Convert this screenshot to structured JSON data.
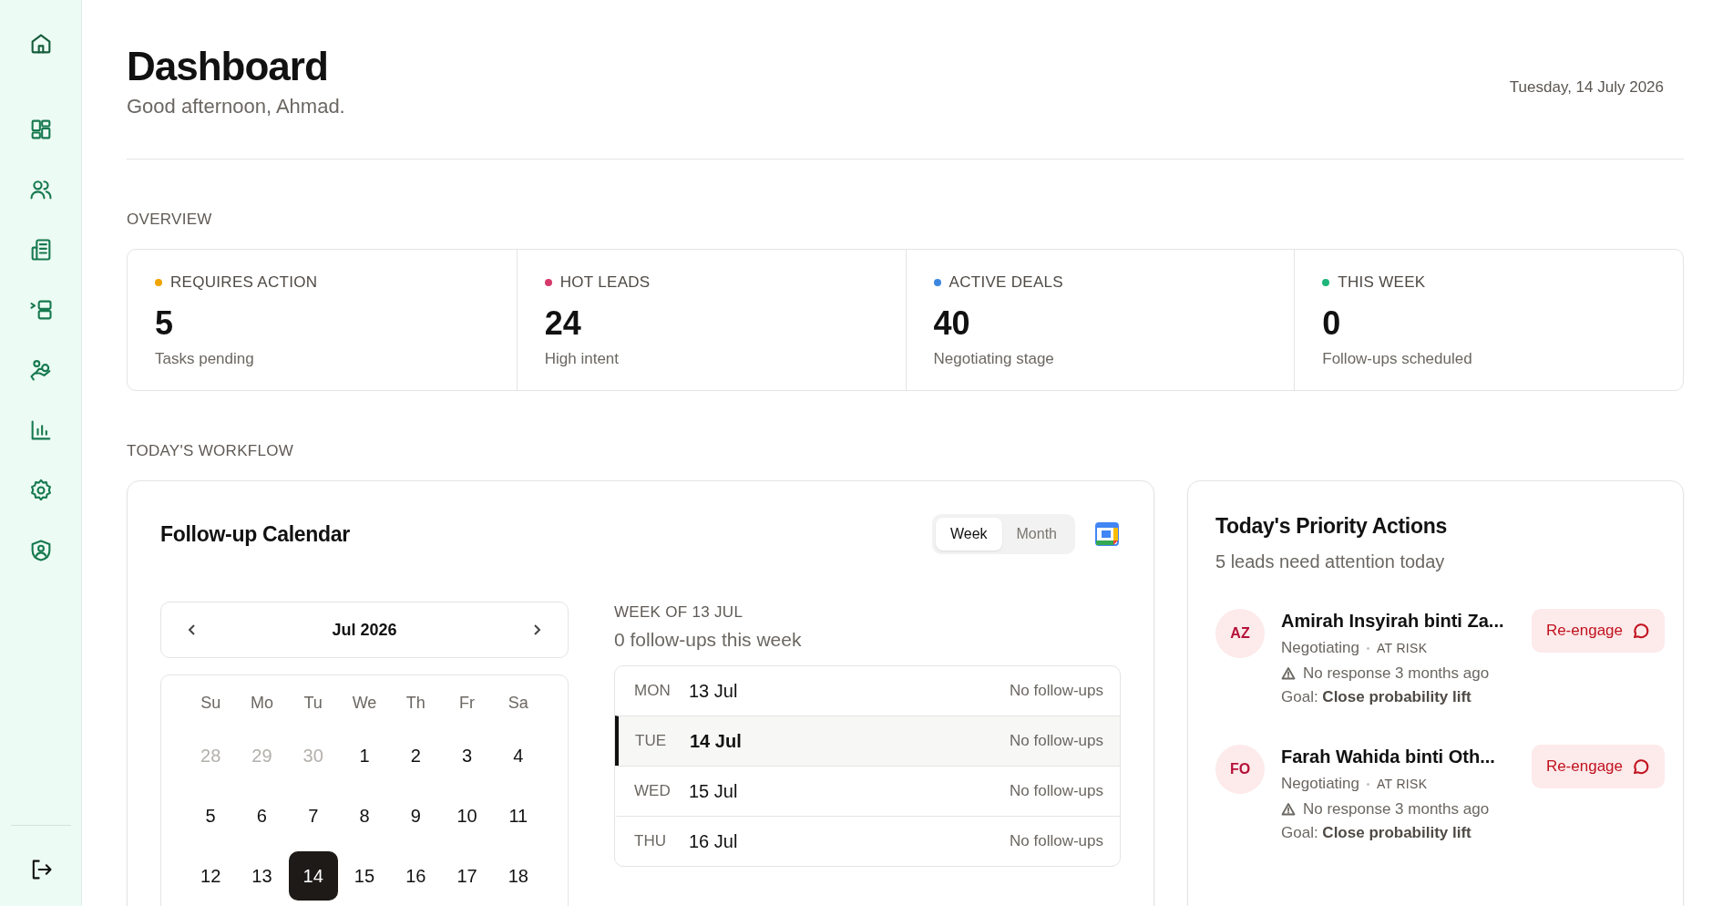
{
  "header": {
    "title": "Dashboard",
    "greeting": "Good afternoon, Ahmad.",
    "date": "Tuesday, 14 July 2026"
  },
  "overview": {
    "heading": "OVERVIEW",
    "cards": [
      {
        "label": "REQUIRES ACTION",
        "color": "#f0a500",
        "value": "5",
        "caption": "Tasks pending"
      },
      {
        "label": "HOT LEADS",
        "color": "#d63a6b",
        "value": "24",
        "caption": "High intent"
      },
      {
        "label": "ACTIVE DEALS",
        "color": "#3b87e0",
        "value": "40",
        "caption": "Negotiating stage"
      },
      {
        "label": "THIS WEEK",
        "color": "#1fb57a",
        "value": "0",
        "caption": "Follow-ups scheduled"
      }
    ]
  },
  "workflow": {
    "heading": "TODAY'S WORKFLOW",
    "calendar": {
      "title": "Follow-up Calendar",
      "views": [
        {
          "label": "Week",
          "selected": true
        },
        {
          "label": "Month",
          "selected": false
        }
      ],
      "month": "Jul 2026",
      "weekdays": [
        "Su",
        "Mo",
        "Tu",
        "We",
        "Th",
        "Fr",
        "Sa"
      ],
      "days": [
        {
          "day": "28",
          "outside": true,
          "selected": false
        },
        {
          "day": "29",
          "outside": true,
          "selected": false
        },
        {
          "day": "30",
          "outside": true,
          "selected": false
        },
        {
          "day": "1",
          "outside": false,
          "selected": false
        },
        {
          "day": "2",
          "outside": false,
          "selected": false
        },
        {
          "day": "3",
          "outside": false,
          "selected": false
        },
        {
          "day": "4",
          "outside": false,
          "selected": false
        },
        {
          "day": "5",
          "outside": false,
          "selected": false
        },
        {
          "day": "6",
          "outside": false,
          "selected": false
        },
        {
          "day": "7",
          "outside": false,
          "selected": false
        },
        {
          "day": "8",
          "outside": false,
          "selected": false
        },
        {
          "day": "9",
          "outside": false,
          "selected": false
        },
        {
          "day": "10",
          "outside": false,
          "selected": false
        },
        {
          "day": "11",
          "outside": false,
          "selected": false
        },
        {
          "day": "12",
          "outside": false,
          "selected": false
        },
        {
          "day": "13",
          "outside": false,
          "selected": false
        },
        {
          "day": "14",
          "outside": false,
          "selected": true
        },
        {
          "day": "15",
          "outside": false,
          "selected": false
        },
        {
          "day": "16",
          "outside": false,
          "selected": false
        },
        {
          "day": "17",
          "outside": false,
          "selected": false
        },
        {
          "day": "18",
          "outside": false,
          "selected": false
        }
      ],
      "week_heading": "WEEK OF 13 JUL",
      "week_summary": "0 follow-ups this week",
      "week_days": [
        {
          "label": "MON",
          "date": "13 Jul",
          "status": "No follow-ups",
          "selected": false
        },
        {
          "label": "TUE",
          "date": "14 Jul",
          "status": "No follow-ups",
          "selected": true
        },
        {
          "label": "WED",
          "date": "15 Jul",
          "status": "No follow-ups",
          "selected": false
        },
        {
          "label": "THU",
          "date": "16 Jul",
          "status": "No follow-ups",
          "selected": false
        }
      ]
    },
    "priority": {
      "title": "Today's Priority Actions",
      "subtitle": "5 leads need attention today",
      "leads": [
        {
          "initials": "AZ",
          "name": "Amirah Insyirah binti Za...",
          "stage": "Negotiating",
          "risk": "AT RISK",
          "warning": "No response 3 months ago",
          "goal": "Goal: **Close probability lift**",
          "action": "Re-engage"
        },
        {
          "initials": "FO",
          "name": "Farah Wahida binti Oth...",
          "stage": "Negotiating",
          "risk": "AT RISK",
          "warning": "No response 3 months ago",
          "goal": "Goal: **Close probability lift**",
          "action": "Re-engage"
        }
      ]
    }
  }
}
